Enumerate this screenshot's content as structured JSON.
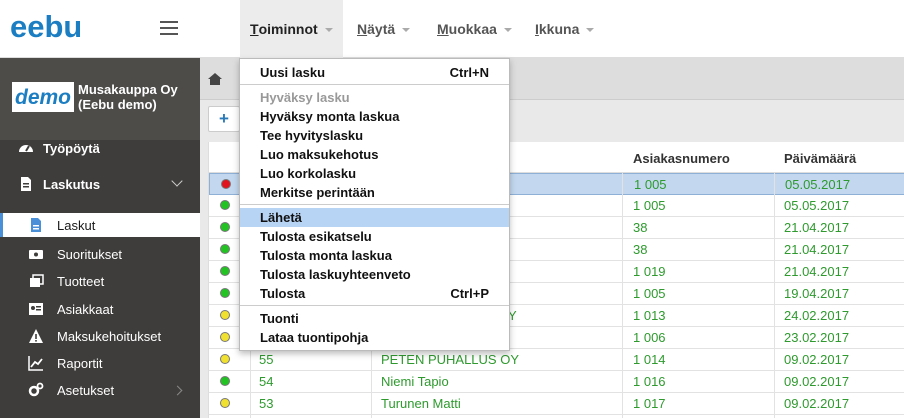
{
  "app": {
    "logo_text": "eebu",
    "brand_color": "#1c7ec2"
  },
  "menubar": [
    {
      "label": "Toiminnot",
      "underline": "T",
      "rest": "oiminnot",
      "active": true
    },
    {
      "label": "Näytä",
      "underline": "N",
      "rest": "äytä"
    },
    {
      "label": "Muokkaa",
      "underline": "M",
      "rest": "uokkaa"
    },
    {
      "label": "Ikkuna",
      "underline": "I",
      "rest": "kkuna"
    }
  ],
  "company": {
    "logo_text": "demo",
    "name_line1": "Musakauppa Oy",
    "name_line2": "(Eebu demo)"
  },
  "sidebar": {
    "items": [
      {
        "label": "Työpöytä",
        "icon": "dashboard-icon"
      },
      {
        "label": "Laskutus",
        "icon": "invoice-icon"
      },
      {
        "label": "Laskut",
        "icon": "document-icon"
      },
      {
        "label": "Suoritukset",
        "icon": "cash-icon"
      },
      {
        "label": "Tuotteet",
        "icon": "products-icon"
      },
      {
        "label": "Asiakkaat",
        "icon": "contacts-icon"
      },
      {
        "label": "Maksukehoitukset",
        "icon": "warning-icon"
      },
      {
        "label": "Raportit",
        "icon": "chart-icon"
      },
      {
        "label": "Asetukset",
        "icon": "gears-icon"
      }
    ]
  },
  "toolbar": {
    "add_label": "+"
  },
  "table": {
    "headers": {
      "customer_number": "Asiakasnumero",
      "date": "Päivämäärä"
    },
    "rows": [
      {
        "status": "red",
        "num": "",
        "name": "",
        "cust": "1 005",
        "date": "05.05.2017",
        "selected": true
      },
      {
        "status": "green",
        "num": "",
        "name": "",
        "cust": "1 005",
        "date": "05.05.2017"
      },
      {
        "status": "green",
        "num": "",
        "name": "",
        "cust": "38",
        "date": "21.04.2017"
      },
      {
        "status": "green",
        "num": "",
        "name": "",
        "cust": "38",
        "date": "21.04.2017"
      },
      {
        "status": "green",
        "num": "",
        "name": "",
        "cust": "1 019",
        "date": "21.04.2017"
      },
      {
        "status": "green",
        "num": "",
        "name": "",
        "cust": "1 005",
        "date": "19.04.2017"
      },
      {
        "status": "yellow",
        "num": "",
        "name": "Y",
        "cust": "1 013",
        "date": "24.02.2017"
      },
      {
        "status": "yellow",
        "num": "",
        "name": "",
        "cust": "1 006",
        "date": "23.02.2017"
      },
      {
        "status": "yellow",
        "num": "55",
        "name": "PETEN PUHALLUS OY",
        "cust": "1 014",
        "date": "09.02.2017"
      },
      {
        "status": "green",
        "num": "54",
        "name": "Niemi Tapio",
        "cust": "1 016",
        "date": "09.02.2017"
      },
      {
        "status": "yellow",
        "num": "53",
        "name": "Turunen Matti",
        "cust": "1 017",
        "date": "09.02.2017"
      }
    ]
  },
  "dropdown": {
    "groups": [
      [
        {
          "label": "Uusi lasku",
          "shortcut": "Ctrl+N"
        }
      ],
      [
        {
          "label": "Hyväksy lasku",
          "disabled": true
        },
        {
          "label": "Hyväksy monta laskua"
        },
        {
          "label": "Tee hyvityslasku"
        },
        {
          "label": "Luo maksukehotus"
        },
        {
          "label": "Luo korkolasku"
        },
        {
          "label": "Merkitse perintään"
        }
      ],
      [
        {
          "label": "Lähetä",
          "highlighted": true
        },
        {
          "label": "Tulosta esikatselu"
        },
        {
          "label": "Tulosta monta laskua"
        },
        {
          "label": "Tulosta laskuyhteenveto"
        },
        {
          "label": "Tulosta",
          "shortcut": "Ctrl+P"
        }
      ],
      [
        {
          "label": "Tuonti"
        },
        {
          "label": "Lataa tuontipohja"
        }
      ]
    ]
  }
}
